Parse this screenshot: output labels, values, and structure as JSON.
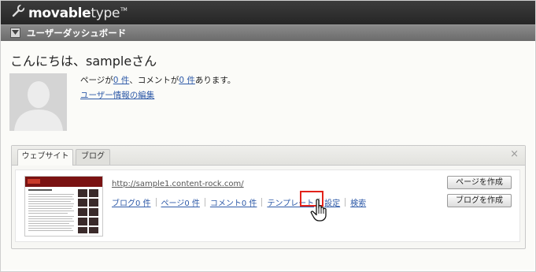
{
  "app": {
    "logo_main": "movable",
    "logo_sub": "type",
    "logo_tm": "TM"
  },
  "dashboard": {
    "title": "ユーザーダッシュボード"
  },
  "greeting": "こんにちは、sampleさん",
  "stats": {
    "prefix": "ページが",
    "pages": "0 件",
    "middle": "、コメントが",
    "comments": "0 件",
    "suffix": "あります。"
  },
  "edit_profile": "ユーザー情報の編集",
  "widget": {
    "tabs": [
      {
        "label": "ウェブサイト",
        "active": true
      },
      {
        "label": "ブログ",
        "active": false
      }
    ],
    "close": "×",
    "site": {
      "url": "http://sample1.content-rock.com/",
      "links": [
        "ブログ0 件",
        "ページ0 件",
        "コメント0 件",
        "テンプレート",
        "設定",
        "検索"
      ],
      "buttons": {
        "create_page": "ページを作成",
        "create_blog": "ブログを作成"
      }
    }
  },
  "colors": {
    "highlight": "#e3231b",
    "link": "#2e5aa8"
  }
}
